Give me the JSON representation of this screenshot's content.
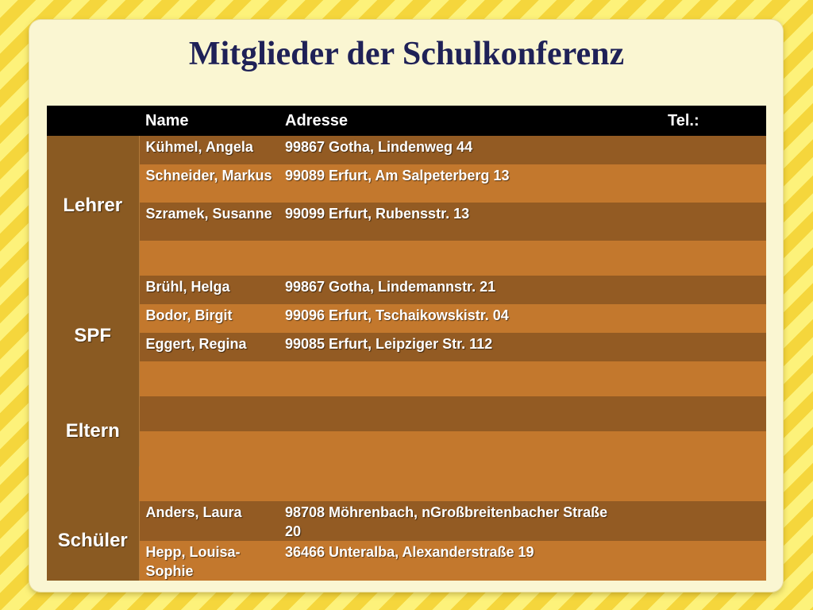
{
  "title": "Mitglieder der Schulkonferenz",
  "table": {
    "headers": {
      "col0": "",
      "name": "Name",
      "address": "Adresse",
      "phone": "Tel.:"
    },
    "groups": {
      "lehrer": "Lehrer",
      "spf": "SPF",
      "eltern": "Eltern",
      "schueler": "Schüler"
    },
    "rows": {
      "lehrer": [
        {
          "name": "Kühmel, Angela",
          "address": "99867 Gotha, Lindenweg 44",
          "phone": ""
        },
        {
          "name": "Schneider, Markus",
          "address": "99089 Erfurt, Am Salpeterberg 13",
          "phone": ""
        },
        {
          "name": "Szramek, Susanne",
          "address": "99099 Erfurt, Rubensstr. 13",
          "phone": ""
        }
      ],
      "spf": [
        {
          "name": "Brühl, Helga",
          "address": "99867 Gotha, Lindemannstr. 21",
          "phone": ""
        },
        {
          "name": "Bodor, Birgit",
          "address": "99096 Erfurt, Tschaikowskistr. 04",
          "phone": ""
        },
        {
          "name": "Eggert, Regina",
          "address": "99085 Erfurt, Leipziger Str. 112",
          "phone": ""
        }
      ],
      "schueler": [
        {
          "name": "Anders, Laura",
          "address": "98708 Möhrenbach, nGroßbreitenbacher Straße 20",
          "phone": ""
        },
        {
          "name": "Hepp, Louisa-Sophie",
          "address": "36466 Unteralba, Alexanderstraße 19",
          "phone": ""
        }
      ]
    }
  }
}
